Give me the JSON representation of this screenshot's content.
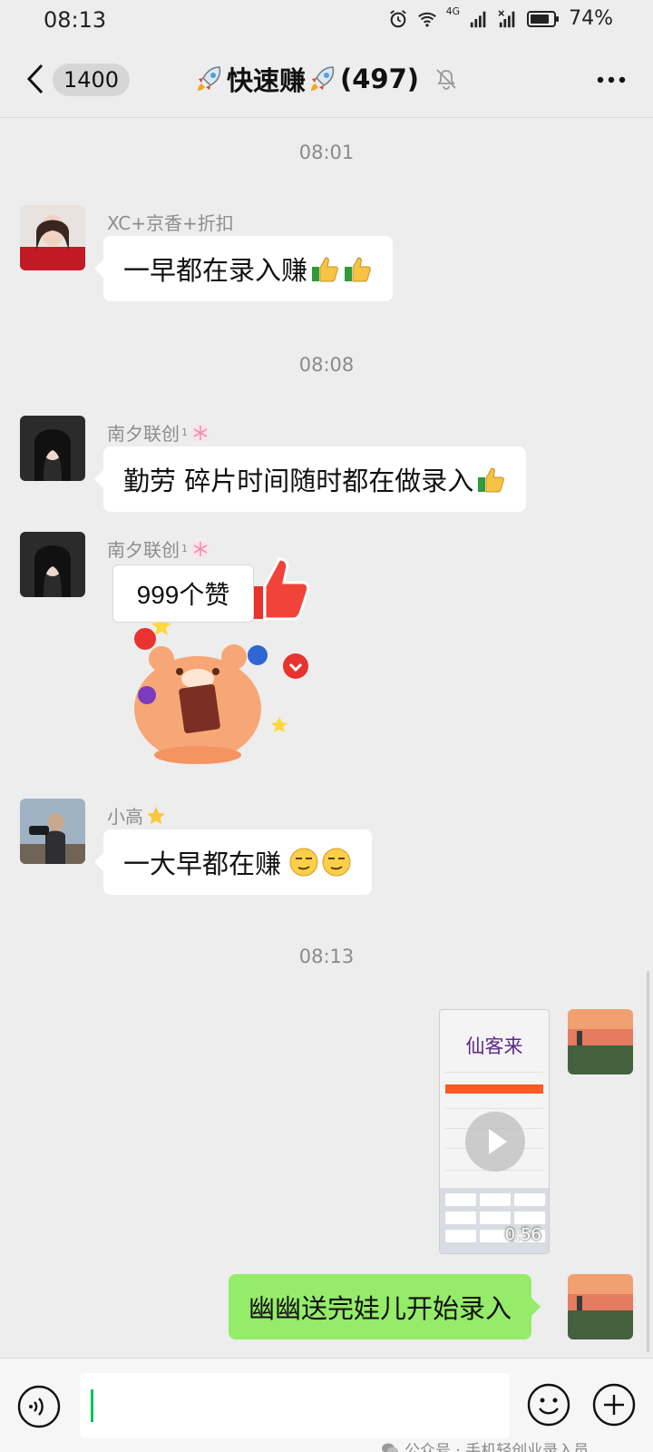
{
  "status_bar": {
    "time": "08:13",
    "battery": "74%",
    "network_label": "4G",
    "icons": [
      "alarm-icon",
      "wifi-icon",
      "signal-icon",
      "signal-icon",
      "battery-icon"
    ]
  },
  "nav": {
    "unread_count": "1400",
    "title": "快速赚",
    "member_count": "(497)",
    "title_emoji": "rocket-icon",
    "icons": [
      "back-icon",
      "mute-icon",
      "more-icon"
    ]
  },
  "messages": [
    {
      "type": "time",
      "text": "08:01"
    },
    {
      "type": "text",
      "side": "left",
      "sender": "XC+京香+折扣",
      "text": "一早都在录入赚",
      "emoji": [
        "thumbs-up-icon",
        "thumbs-up-icon"
      ]
    },
    {
      "type": "time",
      "text": "08:08"
    },
    {
      "type": "text",
      "side": "left",
      "sender": "南夕联创",
      "sender_sup": "1",
      "text": "勤劳 碎片时间随时都在做录入",
      "emoji": [
        "thumbs-up-icon"
      ]
    },
    {
      "type": "sticker",
      "side": "left",
      "sender": "南夕联创",
      "sender_sup": "1",
      "sticker_text": "999个赞"
    },
    {
      "type": "text",
      "side": "left",
      "sender": "小高",
      "text": "一大早都在赚",
      "emoji": [
        "smirk-icon",
        "smirk-icon"
      ]
    },
    {
      "type": "time",
      "text": "08:13"
    },
    {
      "type": "video",
      "side": "right",
      "video_title": "仙客来",
      "duration": "0:56"
    },
    {
      "type": "text",
      "side": "right",
      "text": "幽幽送完娃儿开始录入"
    }
  ],
  "input_bar": {
    "placeholder": "",
    "icons": [
      "voice-icon",
      "emoji-icon",
      "plus-icon"
    ]
  },
  "watermark": "公众号 · 手机轻创业录入员",
  "colors": {
    "background": "#ededed",
    "self_bubble": "#95ec69",
    "other_bubble": "#ffffff",
    "accent": "#07c160"
  }
}
